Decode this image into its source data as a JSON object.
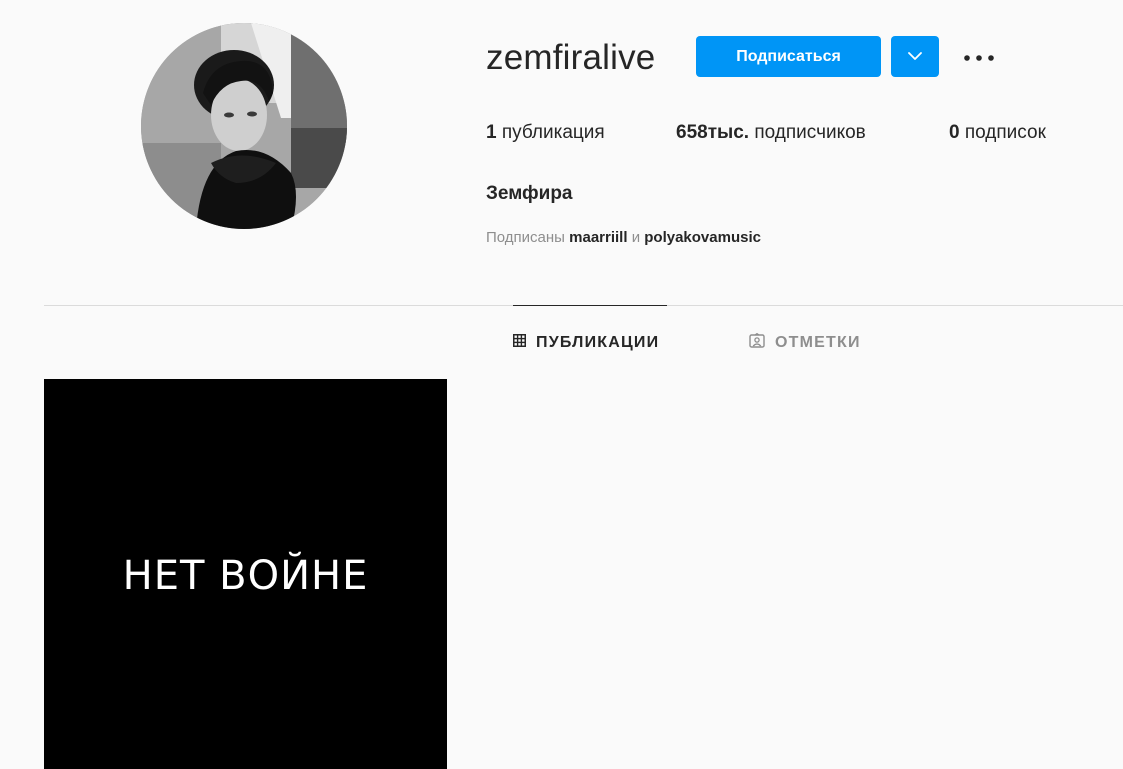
{
  "profile": {
    "username": "zemfiralive",
    "full_name": "Земфира",
    "follow_label": "Подписаться"
  },
  "stats": {
    "posts_count": "1",
    "posts_label": "публикация",
    "followers_count": "658тыс.",
    "followers_label": "подписчиков",
    "following_count": "0",
    "following_label": "подписок"
  },
  "followed_by": {
    "prefix": "Подписаны",
    "account_1": "maarriill",
    "conjunction": "и",
    "account_2": "polyakovamusic"
  },
  "tabs": [
    {
      "label": "ПУБЛИКАЦИИ",
      "icon": "grid-icon",
      "active": true
    },
    {
      "label": "ОТМЕТКИ",
      "icon": "tagged-icon",
      "active": false
    }
  ],
  "posts": [
    {
      "text": "НЕТ ВОЙНЕ"
    }
  ],
  "colors": {
    "accent": "#0095f6",
    "background": "#fafafa",
    "text": "#262626",
    "muted": "#8e8e8e"
  }
}
